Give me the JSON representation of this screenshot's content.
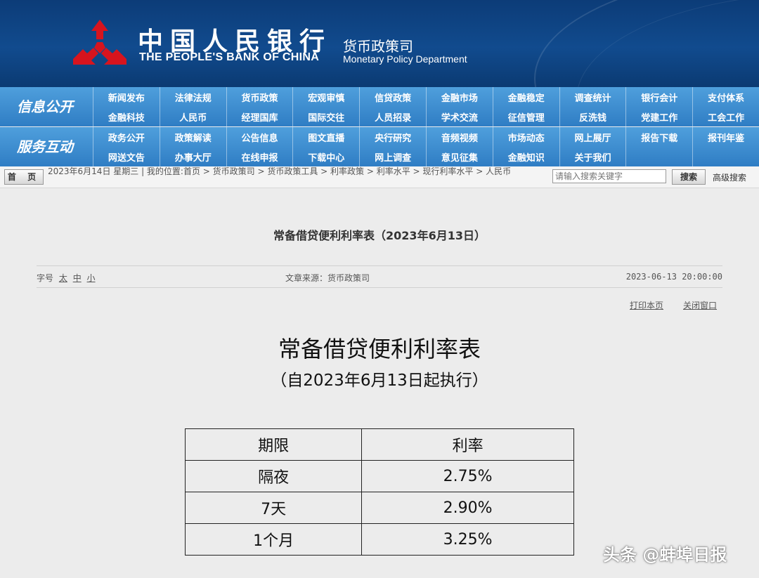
{
  "header": {
    "bank_name_cn": "中国人民银行",
    "bank_name_en": "THE PEOPLE'S BANK OF CHINA",
    "dept_cn": "货币政策司",
    "dept_en": "Monetary Policy Department",
    "bg_color": "#0c3c78",
    "emblem_color": "#d7141e"
  },
  "nav": {
    "section1_label": "信息公开",
    "section1_items": [
      "新闻发布",
      "法律法规",
      "货币政策",
      "宏观审慎",
      "信贷政策",
      "金融市场",
      "金融稳定",
      "调查统计",
      "银行会计",
      "支付体系",
      "金融科技",
      "人民币",
      "经理国库",
      "国际交往",
      "人员招录",
      "学术交流",
      "征信管理",
      "反洗钱",
      "党建工作",
      "工会工作"
    ],
    "section2_label": "服务互动",
    "section2_items": [
      "政务公开",
      "政策解读",
      "公告信息",
      "图文直播",
      "央行研究",
      "音频视频",
      "市场动态",
      "网上展厅",
      "报告下载",
      "报刊年鉴",
      "网送文告",
      "办事大厅",
      "在线申报",
      "下载中心",
      "网上调查",
      "意见征集",
      "金融知识",
      "关于我们",
      "",
      ""
    ]
  },
  "breadcrumb": {
    "home_label": "首 页",
    "text": "2023年6月14日 星期三 | 我的位置:首页 > 货币政策司 > 货币政策工具 > 利率政策 > 利率水平 > 现行利率水平 > 人民币",
    "search_placeholder": "请输入搜索关键字",
    "search_button": "搜索",
    "advanced_search": "高级搜索"
  },
  "article": {
    "title": "常备借贷便利利率表（2023年6月13日）",
    "font_size_label": "字号",
    "font_sizes": [
      "太",
      "中",
      "小"
    ],
    "source": "文章来源：货币政策司",
    "date": "2023-06-13 20:00:00",
    "print_label": "打印本页",
    "close_label": "关闭窗口",
    "heading": "常备借贷便利利率表",
    "subheading": "（自2023年6月13日起执行）"
  },
  "rate_table": {
    "headers": [
      "期限",
      "利率"
    ],
    "rows": [
      [
        "隔夜",
        "2.75%"
      ],
      [
        "7天",
        "2.90%"
      ],
      [
        "1个月",
        "3.25%"
      ]
    ]
  },
  "watermark": "头条 @蚌埠日报"
}
